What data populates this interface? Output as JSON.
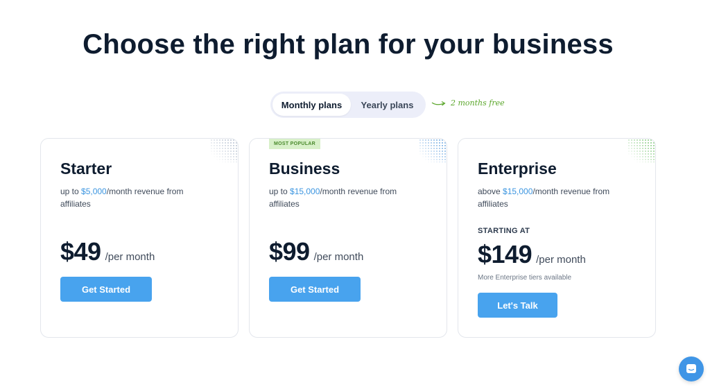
{
  "header": {
    "title": "Choose the right plan for your business"
  },
  "billing_toggle": {
    "options": [
      "Monthly plans",
      "Yearly plans"
    ],
    "selected": "Monthly plans",
    "note": "2 months free"
  },
  "plans": [
    {
      "name": "Starter",
      "desc_prefix": "up to ",
      "desc_amount": "$5,000",
      "desc_suffix": "/month revenue from affiliates",
      "price": "$49",
      "period": "/per month",
      "cta": "Get Started"
    },
    {
      "badge": "MOST POPULAR",
      "name": "Business",
      "desc_prefix": "up to ",
      "desc_amount": "$15,000",
      "desc_suffix": "/month revenue from affiliates",
      "price": "$99",
      "period": "/per month",
      "cta": "Get Started"
    },
    {
      "name": "Enterprise",
      "desc_prefix": "above ",
      "desc_amount": "$15,000",
      "desc_suffix": "/month revenue from affiliates",
      "starting_label": "STARTING AT",
      "price": "$149",
      "period": "/per month",
      "note": "More Enterprise tiers available",
      "cta": "Let's Talk"
    }
  ],
  "icons": {
    "note_arrow": "curved-arrow-icon",
    "chat": "chat-icon"
  },
  "colors": {
    "accent": "#48a3ee",
    "highlight": "#3b95e0",
    "badge_bg": "#d8f0c9",
    "note_green": "#5aa62a"
  }
}
